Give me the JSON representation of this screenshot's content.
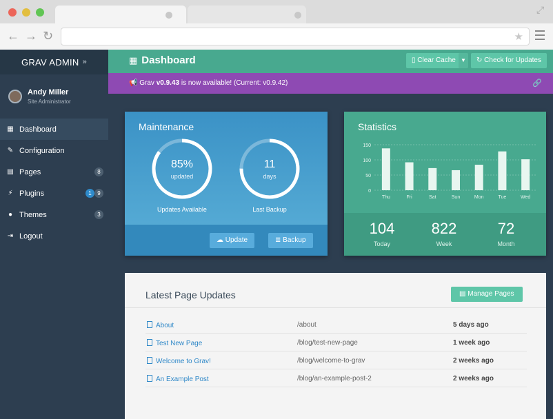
{
  "sidebar": {
    "brand": "GRAV ADMIN",
    "brand_chevron": "»",
    "user": {
      "name": "Andy Miller",
      "role": "Site Administrator"
    },
    "items": [
      {
        "label": "Dashboard",
        "icon": "grid-icon",
        "badges": []
      },
      {
        "label": "Configuration",
        "icon": "wrench-icon",
        "badges": []
      },
      {
        "label": "Pages",
        "icon": "file-icon",
        "badges": [
          "8"
        ]
      },
      {
        "label": "Plugins",
        "icon": "plug-icon",
        "badges": [
          "1",
          "9"
        ]
      },
      {
        "label": "Themes",
        "icon": "tint-icon",
        "badges": [
          "3"
        ]
      },
      {
        "label": "Logout",
        "icon": "sign-out-icon",
        "badges": []
      }
    ]
  },
  "header": {
    "title": "Dashboard",
    "clear_cache": "Clear Cache",
    "check_updates": "Check for Updates"
  },
  "notice": {
    "prefix": "Grav ",
    "version": "v0.9.43",
    "suffix": " is now available! (Current: v0.9.42)"
  },
  "maintenance": {
    "title": "Maintenance",
    "updates": {
      "value": "85%",
      "sub": "updated",
      "label": "Updates Available",
      "fraction": 0.85
    },
    "backup": {
      "value": "11",
      "sub": "days",
      "label": "Last Backup",
      "fraction": 0.75
    },
    "update_button": "Update",
    "backup_button": "Backup"
  },
  "statistics": {
    "title": "Statistics",
    "today": {
      "value": "104",
      "label": "Today"
    },
    "week": {
      "value": "822",
      "label": "Week"
    },
    "month": {
      "value": "72",
      "label": "Month"
    }
  },
  "chart_data": {
    "type": "bar",
    "categories": [
      "Thu",
      "Fri",
      "Sat",
      "Sun",
      "Mon",
      "Tue",
      "Wed"
    ],
    "values": [
      138,
      92,
      73,
      66,
      84,
      128,
      102
    ],
    "yticks": [
      "150",
      "100",
      "50",
      "0"
    ],
    "ylim": [
      0,
      150
    ]
  },
  "updates": {
    "title": "Latest Page Updates",
    "manage_button": "Manage Pages",
    "rows": [
      {
        "title": "About",
        "route": "/about",
        "when": "5 days ago"
      },
      {
        "title": "Test New Page",
        "route": "/blog/test-new-page",
        "when": "1 week ago"
      },
      {
        "title": "Welcome to Grav!",
        "route": "/blog/welcome-to-grav",
        "when": "2 weeks ago"
      },
      {
        "title": "An Example Post",
        "route": "/blog/an-example-post-2",
        "when": "2 weeks ago"
      }
    ]
  },
  "colors": {
    "header": "#48a98f",
    "notice": "#8e4ab3",
    "maintenance": "#3b92c6",
    "statistics": "#48a98f",
    "sidebar": "#2d3e50"
  }
}
